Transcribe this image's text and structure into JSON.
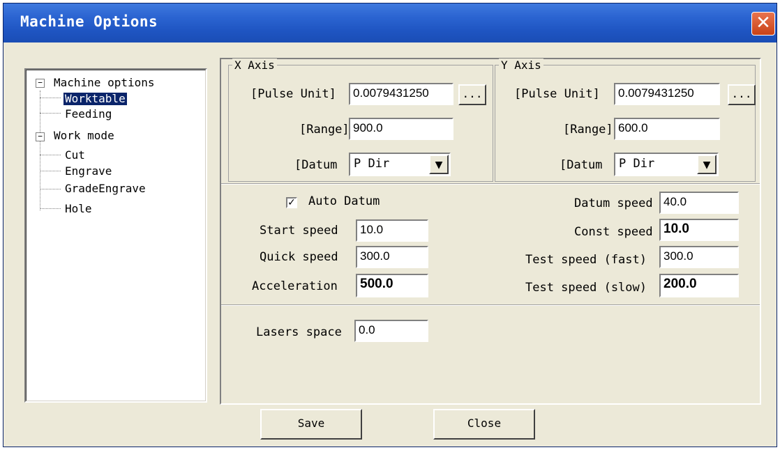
{
  "window": {
    "title": "Machine Options",
    "close_glyph": "✕"
  },
  "tree": {
    "items": [
      {
        "label": "Machine options",
        "expander": "−"
      },
      {
        "label": "Worktable"
      },
      {
        "label": "Feeding"
      },
      {
        "label": "Work mode",
        "expander": "−"
      },
      {
        "label": "Cut"
      },
      {
        "label": "Engrave"
      },
      {
        "label": "GradeEngrave"
      },
      {
        "label": "Hole"
      }
    ],
    "selected": "Worktable"
  },
  "x_axis": {
    "group_label": "X Axis",
    "pulse_unit_label": "[Pulse Unit]",
    "pulse_unit_value": "0.0079431250",
    "browse_label": "...",
    "range_label": "[Range]",
    "range_value": "900.0",
    "datum_label": "[Datum",
    "datum_value": "P Dir"
  },
  "y_axis": {
    "group_label": "Y Axis",
    "pulse_unit_label": "[Pulse Unit]",
    "pulse_unit_value": "0.0079431250",
    "browse_label": "...",
    "range_label": "[Range]",
    "range_value": "600.0",
    "datum_label": "[Datum",
    "datum_value": "P Dir"
  },
  "speeds": {
    "auto_datum_label": "Auto Datum",
    "auto_datum_checked": true,
    "check_glyph": "✓",
    "start_speed_label": "Start speed",
    "start_speed_value": "10.0",
    "quick_speed_label": "Quick speed",
    "quick_speed_value": "300.0",
    "acceleration_label": "Acceleration",
    "acceleration_value": "500.0",
    "datum_speed_label": "Datum speed",
    "datum_speed_value": "40.0",
    "const_speed_label": "Const speed",
    "const_speed_value": "10.0",
    "test_fast_label": "Test speed (fast)",
    "test_fast_value": "300.0",
    "test_slow_label": "Test speed (slow)",
    "test_slow_value": "200.0"
  },
  "lasers": {
    "space_label": "Lasers space",
    "space_value": "0.0"
  },
  "buttons": {
    "save": "Save",
    "close": "Close"
  },
  "dropdown_glyph": "▼"
}
